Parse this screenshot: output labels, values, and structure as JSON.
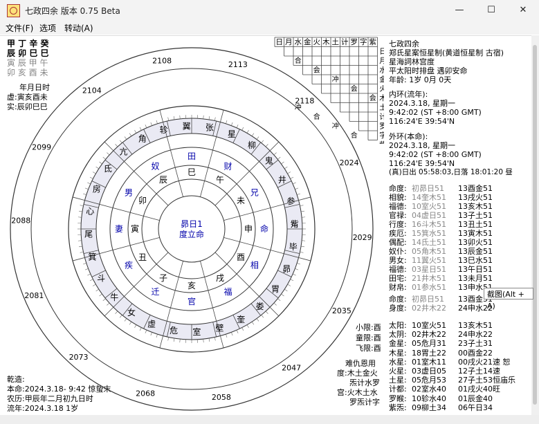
{
  "window": {
    "title": "七政四余 版本 0.75 Beta",
    "minimize": "—",
    "maximize": "☐",
    "close": "✕"
  },
  "menu": [
    {
      "label": "文件(F)"
    },
    {
      "label": "选项"
    },
    {
      "label": "转动(A)"
    }
  ],
  "left_top": {
    "row1": "甲 丁 辛 癸",
    "row2": "辰 卯 巳 巳",
    "row3": "寅 辰 甲 午",
    "row4": "卯 亥 酉 未",
    "row5": "年月日时",
    "row6": "虚:寅亥酉未",
    "row7": "实:辰卯巳巳"
  },
  "left_bottom": {
    "row1": "乾造:",
    "row2": "本命:2024.3.18- 9:42 惊蛰末",
    "row3": "农历:甲辰年二月初九日时",
    "row4": "流年:2024.3.18 1岁"
  },
  "wheel": {
    "center_line1": "昴日1",
    "center_line2": "度立命",
    "inner_branches": [
      "午",
      "未",
      "申",
      "酉",
      "戌",
      "亥",
      "子",
      "丑",
      "寅",
      "卯",
      "辰",
      "巳"
    ],
    "palaces": [
      "财帛",
      "兄弟",
      "命宫",
      "相貌",
      "福德",
      "官禄",
      "迁移",
      "疾厄",
      "妻妾",
      "男女",
      "奴仆",
      "田宅"
    ],
    "mansions": [
      "张",
      "星",
      "柳",
      "鬼",
      "井",
      "参",
      "觜",
      "毕",
      "昴",
      "胃",
      "娄",
      "奎",
      "壁",
      "室",
      "危",
      "虚",
      "女",
      "牛",
      "斗",
      "箕",
      "尾",
      "心",
      "房",
      "氐",
      "亢",
      "角",
      "轸",
      "翼"
    ],
    "outer_years": [
      "2108",
      "2113",
      "2118",
      "2024",
      "2029",
      "2035",
      "2047",
      "2058",
      "2068",
      "2073",
      "2081",
      "2088",
      "2099",
      "2104"
    ]
  },
  "grid": {
    "header": [
      "日",
      "月",
      "水",
      "金",
      "火",
      "木",
      "土",
      "计",
      "罗",
      "字",
      "紫"
    ],
    "side": [
      "日",
      "月",
      "水",
      "金",
      "火",
      "木",
      "土",
      "计",
      "罗",
      "字",
      "紫"
    ],
    "cells_sample": [
      "合",
      "会",
      "冲",
      "会",
      "会",
      "冲",
      "合",
      "冲",
      "合"
    ]
  },
  "right_panel": {
    "title1": "七政四余",
    "title2": "郑氏星案恒星制(黄道恒星制 古宿)",
    "title3": "星海詞林宫度",
    "title4": "平太阳时排盘 遇卯安命",
    "title5": "年龄: 1岁 0月 0天",
    "inner_label": "内环(流年):",
    "inner_date": "2024.3.18, 星期一",
    "inner_time": "9:42:02 (ST +8:00 GMT)",
    "inner_coord": "116:24'E   39:54'N",
    "outer_label": "外环(本命):",
    "outer_date": "2024.3.18, 星期一",
    "outer_time": "9:42:02 (ST +8:00 GMT)",
    "outer_coord": "116:24'E   39:54'N",
    "sunrise": "(真)日出 05:58:03,日落 18:01:20 昼",
    "palace_rows": [
      [
        "命度:",
        "初昴日51",
        "13酉金51"
      ],
      [
        "相貌:",
        "14奎木51",
        "13戌火51"
      ],
      [
        "福德:",
        "10室火51",
        "13亥木51"
      ],
      [
        "官禄:",
        "04虚日51",
        "13子土51"
      ],
      [
        "行度:",
        "16斗木51",
        "13丑土51"
      ],
      [
        "疾厄:",
        "15箕水51",
        "13寅木51"
      ],
      [
        "偶配:",
        "14氐土51",
        "13卯火51"
      ],
      [
        "奴仆:",
        "05角木51",
        "13辰金51"
      ],
      [
        "男女:",
        "11翼火51",
        "13巳水51"
      ],
      [
        "福德:",
        "03星日51",
        "13午日51"
      ],
      [
        "田宅:",
        "21井木51",
        "13未月51"
      ],
      [
        "财帛:",
        "01参水51",
        "13申水51"
      ]
    ],
    "mingdu": [
      "命度:",
      "初昴日51",
      "13酉金51"
    ],
    "shendu": [
      "身度:",
      "02井木22",
      "24申水22"
    ],
    "stars": [
      [
        "太阳:",
        "10室火51",
        "13亥木51",
        ""
      ],
      [
        "太阴:",
        "02井木22",
        "24申水22",
        ""
      ],
      [
        "金星:",
        "05危月31",
        "23子土31",
        ""
      ],
      [
        "木星:",
        "18胃土22",
        "00酉金22",
        ""
      ],
      [
        "水星:",
        "01室木11",
        "00戌火21",
        "速"
      ],
      [
        "火星:",
        "03虚日05",
        "12子土14",
        "速"
      ],
      [
        "土星:",
        "05危月53",
        "27子土53",
        "恒庙乐"
      ],
      [
        "计都:",
        "02室水40",
        "01戌火40",
        "旺"
      ],
      [
        "罗睺:",
        "10轸水40",
        "01辰金40",
        ""
      ],
      [
        "紫炁:",
        "09柳土34",
        "06午日34",
        ""
      ]
    ],
    "star_notes": [
      "",
      "",
      "",
      "",
      "恕",
      "",
      "",
      "",
      "",
      ""
    ]
  },
  "bottom_mid": {
    "xiaoxian": "小限:酉",
    "tongxian": "童限:酉",
    "feixian": "飞限:酉",
    "nanchou": "难仇恩用",
    "du": "度:木土金火",
    "du2": "炁计水罗",
    "gong": "宫:火木土水",
    "gong2": "罗炁计字"
  },
  "tooltip": "截图(Alt + A)"
}
